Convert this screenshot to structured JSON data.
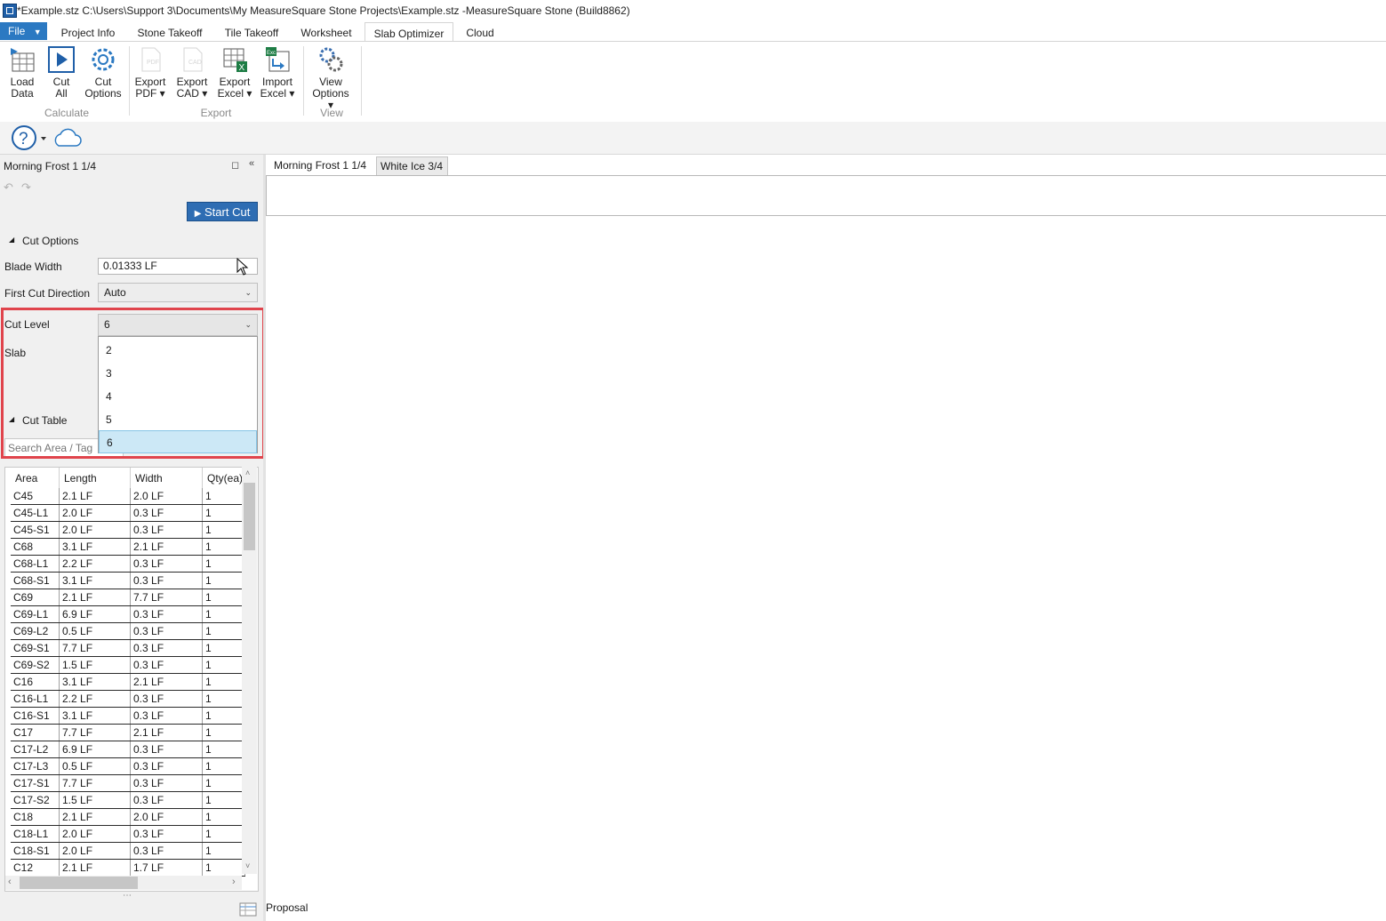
{
  "window": {
    "title": "*Example.stz C:\\Users\\Support 3\\Documents\\My MeasureSquare Stone Projects\\Example.stz -MeasureSquare Stone (Build8862)"
  },
  "ribbon": {
    "file_label": "File",
    "tabs": [
      "Project Info",
      "Stone Takeoff",
      "Tile Takeoff",
      "Worksheet",
      "Slab Optimizer",
      "Cloud"
    ],
    "active_tab": "Slab Optimizer",
    "buttons": {
      "load_data": [
        "Load",
        "Data"
      ],
      "cut_all": [
        "Cut",
        "All"
      ],
      "cut_options": [
        "Cut",
        "Options"
      ],
      "export_pdf": [
        "Export",
        "PDF ▾"
      ],
      "export_cad": [
        "Export",
        "CAD ▾"
      ],
      "export_excel": [
        "Export",
        "Excel ▾"
      ],
      "import_excel": [
        "Import",
        "Excel ▾"
      ],
      "view_options": [
        "View",
        "Options ▾"
      ]
    },
    "groups": {
      "calculate": "Calculate",
      "export": "Export",
      "view": "View"
    }
  },
  "quick_access": {
    "help_icon": "help-icon",
    "cloud_icon": "cloud-icon"
  },
  "left_pane": {
    "title": "Morning Frost 1 1/4",
    "start_cut": "Start Cut",
    "cut_options": {
      "header": "Cut Options",
      "blade_width_label": "Blade Width",
      "blade_width_value": "0.01333 LF",
      "first_cut_label": "First Cut Direction",
      "first_cut_value": "Auto",
      "cut_level_label": "Cut Level",
      "cut_level_value": "6",
      "cut_level_options": [
        "2",
        "3",
        "4",
        "5",
        "6"
      ],
      "slab_label": "Slab"
    },
    "cut_table": {
      "header": "Cut Table",
      "search_placeholder": "Search Area / Tag",
      "columns": [
        "Area",
        "Length",
        "Width",
        "Qty(ea)"
      ],
      "rows": [
        [
          "C45",
          "2.1 LF",
          "2.0 LF",
          "1"
        ],
        [
          "C45-L1",
          "2.0 LF",
          "0.3 LF",
          "1"
        ],
        [
          "C45-S1",
          "2.0 LF",
          "0.3 LF",
          "1"
        ],
        [
          "C68",
          "3.1 LF",
          "2.1 LF",
          "1"
        ],
        [
          "C68-L1",
          "2.2 LF",
          "0.3 LF",
          "1"
        ],
        [
          "C68-S1",
          "3.1 LF",
          "0.3 LF",
          "1"
        ],
        [
          "C69",
          "2.1 LF",
          "7.7 LF",
          "1"
        ],
        [
          "C69-L1",
          "6.9 LF",
          "0.3 LF",
          "1"
        ],
        [
          "C69-L2",
          "0.5 LF",
          "0.3 LF",
          "1"
        ],
        [
          "C69-S1",
          "7.7 LF",
          "0.3 LF",
          "1"
        ],
        [
          "C69-S2",
          "1.5 LF",
          "0.3 LF",
          "1"
        ],
        [
          "C16",
          "3.1 LF",
          "2.1 LF",
          "1"
        ],
        [
          "C16-L1",
          "2.2 LF",
          "0.3 LF",
          "1"
        ],
        [
          "C16-S1",
          "3.1 LF",
          "0.3 LF",
          "1"
        ],
        [
          "C17",
          "7.7 LF",
          "2.1 LF",
          "1"
        ],
        [
          "C17-L2",
          "6.9 LF",
          "0.3 LF",
          "1"
        ],
        [
          "C17-L3",
          "0.5 LF",
          "0.3 LF",
          "1"
        ],
        [
          "C17-S1",
          "7.7 LF",
          "0.3 LF",
          "1"
        ],
        [
          "C17-S2",
          "1.5 LF",
          "0.3 LF",
          "1"
        ],
        [
          "C18",
          "2.1 LF",
          "2.0 LF",
          "1"
        ],
        [
          "C18-L1",
          "2.0 LF",
          "0.3 LF",
          "1"
        ],
        [
          "C18-S1",
          "2.0 LF",
          "0.3 LF",
          "1"
        ],
        [
          "C12",
          "2.1 LF",
          "1.7 LF",
          "1"
        ]
      ]
    }
  },
  "document_tabs": [
    "Morning Frost 1 1/4",
    "White Ice 3/4"
  ],
  "bottom": {
    "proposal_label": "Proposal"
  },
  "colors": {
    "accent": "#2b79c2",
    "start_cut": "#2e6db3",
    "highlight": "#e0444c",
    "selected_item": "#cce8f6"
  }
}
